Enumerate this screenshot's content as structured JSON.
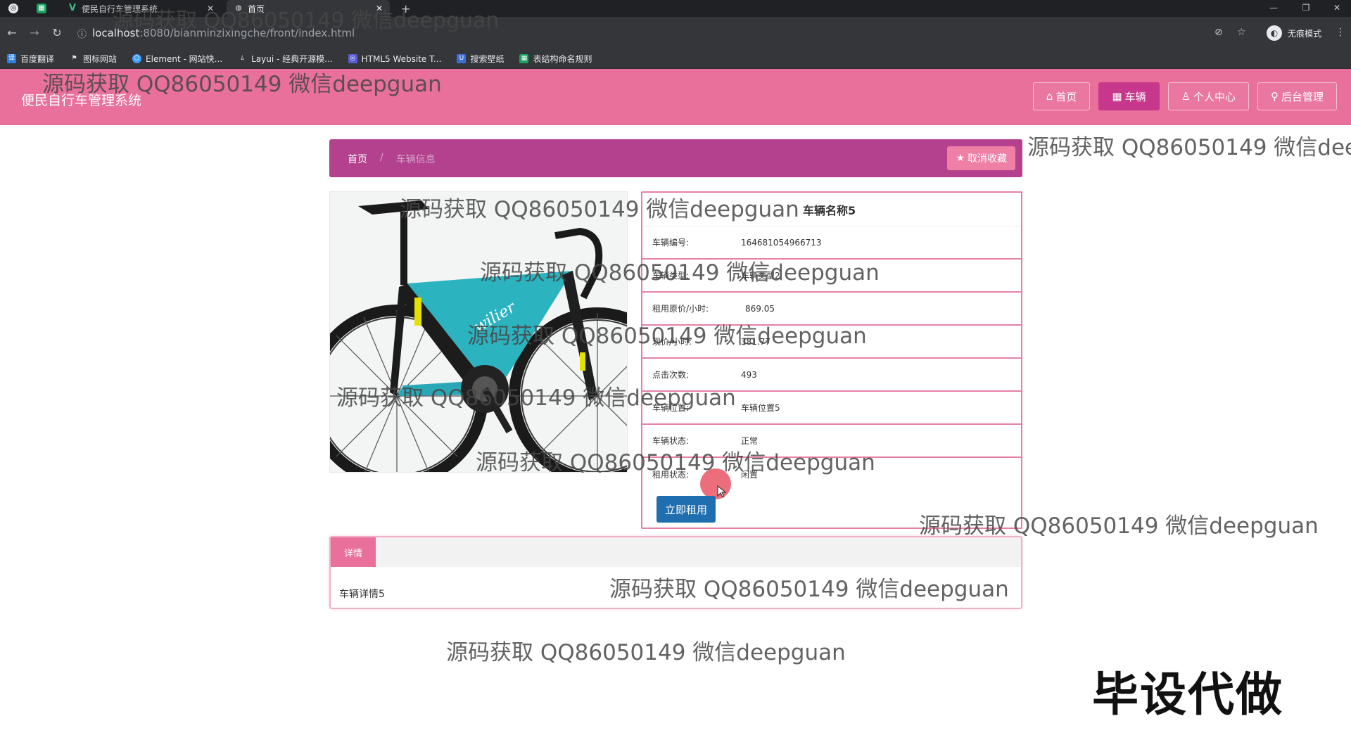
{
  "browser": {
    "tabs": [
      {
        "label": ""
      },
      {
        "label": ""
      },
      {
        "label": "便民自行车管理系统"
      },
      {
        "label": "首页"
      }
    ],
    "new_tab": "+",
    "url_host": "localhost",
    "url_path": ":8080/bianminzixingche/front/index.html",
    "incognito_label": "无痕模式",
    "bookmarks": [
      {
        "label": "百度翻译",
        "color": "#2a7de1"
      },
      {
        "label": "图标网站",
        "color": "#555555"
      },
      {
        "label": "Element - 网站快...",
        "color": "#409eff"
      },
      {
        "label": "Layui - 经典开源模...",
        "color": "#777777"
      },
      {
        "label": "HTML5 Website T...",
        "color": "#5b5bd6"
      },
      {
        "label": "搜索壁纸",
        "color": "#3b6fd8"
      },
      {
        "label": "表结构命名规则",
        "color": "#1aa260"
      }
    ]
  },
  "site": {
    "title": "便民自行车管理系统",
    "nav": [
      {
        "icon": "home-icon",
        "label": "首页"
      },
      {
        "icon": "grid-icon",
        "label": "车辆"
      },
      {
        "icon": "user-icon",
        "label": "个人中心"
      },
      {
        "icon": "link-icon",
        "label": "后台管理"
      }
    ],
    "colors": {
      "header": "#e8709a",
      "crumbbar": "#b3418e",
      "accent": "#c7388d",
      "rent": "#1f6fb0"
    }
  },
  "breadcrumb": {
    "home": "首页",
    "sep": "/",
    "current": "车辆信息",
    "favorite_label": "取消收藏"
  },
  "vehicle": {
    "name": "车辆名称5",
    "fields": [
      {
        "label": "车辆编号:",
        "value": "164681054966713"
      },
      {
        "label": "车辆类型:",
        "value": "车辆类型2"
      },
      {
        "label": "租用原价/小时:",
        "value": "869.05"
      },
      {
        "label": "现价/小时:",
        "value": "381.77"
      },
      {
        "label": "点击次数:",
        "value": "493"
      },
      {
        "label": "车辆位置:",
        "value": "车辆位置5"
      },
      {
        "label": "车辆状态:",
        "value": "正常"
      },
      {
        "label": "租用状态:",
        "value": "闲置"
      }
    ],
    "rent_button": "立即租用"
  },
  "detail": {
    "tab": "详情",
    "content": "车辆详情5"
  },
  "watermarks": [
    "源码获取 QQ86050149 微信deepguan",
    "源码获取 QQ86050149 微信deepguan",
    "源码获取 QQ86050149 微信deep",
    "源码获取 QQ86050149 微信deepguan",
    "源码获取 QQ86050149 微信deepguan",
    "源码获取 QQ86050149 微信deepguan",
    "源码获取 QQ86050149 微信deepguan",
    "源码获取 QQ86050149 微信deepguan",
    "源码获取 QQ86050149 微信deepguan",
    "源码获取 QQ86050149 微信deepguan",
    "源码获取 QQ86050149 微信deepguan"
  ],
  "stamp": "毕设代做"
}
